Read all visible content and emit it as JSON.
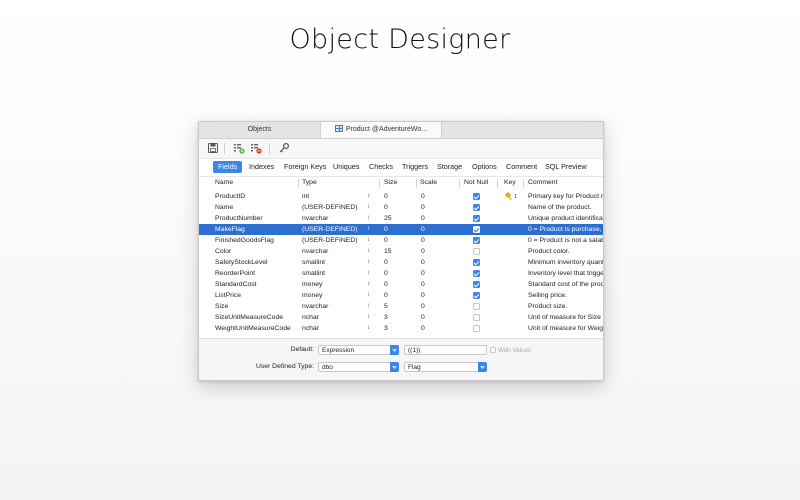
{
  "hero": {
    "title": "Object Designer"
  },
  "tabs": {
    "objects": "Objects",
    "product": "Product @AdventureWo..."
  },
  "subtabs": [
    "Fields",
    "Indexes",
    "Foreign Keys",
    "Uniques",
    "Checks",
    "Triggers",
    "Storage",
    "Options",
    "Comment",
    "SQL Preview"
  ],
  "columns": {
    "name": "Name",
    "type": "Type",
    "size": "Size",
    "scale": "Scale",
    "notnull": "Not Null",
    "key": "Key",
    "comment": "Comment"
  },
  "fields": [
    {
      "name": "ProductID",
      "type": "int",
      "size": "0",
      "scale": "0",
      "notnull": true,
      "key": true,
      "key_index": "1",
      "comment": "Primary key for Product re"
    },
    {
      "name": "Name",
      "type": "(USER-DEFINED)",
      "size": "0",
      "scale": "0",
      "notnull": true,
      "key": false,
      "comment": "Name of the product."
    },
    {
      "name": "ProductNumber",
      "type": "nvarchar",
      "size": "25",
      "scale": "0",
      "notnull": true,
      "key": false,
      "comment": "Unique product identificat"
    },
    {
      "name": "MakeFlag",
      "type": "(USER-DEFINED)",
      "size": "0",
      "scale": "0",
      "notnull": true,
      "key": false,
      "comment": "0 = Product is purchase, 1=",
      "selected": true
    },
    {
      "name": "FinishedGoodsFlag",
      "type": "(USER-DEFINED)",
      "size": "0",
      "scale": "0",
      "notnull": true,
      "key": false,
      "comment": "0 = Product is not a salabl"
    },
    {
      "name": "Color",
      "type": "nvarchar",
      "size": "15",
      "scale": "0",
      "notnull": false,
      "key": false,
      "comment": "Product color."
    },
    {
      "name": "SafetyStockLevel",
      "type": "smallint",
      "size": "0",
      "scale": "0",
      "notnull": true,
      "key": false,
      "comment": "Minimum inventory quanti"
    },
    {
      "name": "ReorderPoint",
      "type": "smallint",
      "size": "0",
      "scale": "0",
      "notnull": true,
      "key": false,
      "comment": "Inventory level that trigger"
    },
    {
      "name": "StandardCost",
      "type": "money",
      "size": "0",
      "scale": "0",
      "notnull": true,
      "key": false,
      "comment": "Standard cost of the produc"
    },
    {
      "name": "ListPrice",
      "type": "money",
      "size": "0",
      "scale": "0",
      "notnull": true,
      "key": false,
      "comment": "Selling price."
    },
    {
      "name": "Size",
      "type": "nvarchar",
      "size": "5",
      "scale": "0",
      "notnull": false,
      "key": false,
      "comment": "Product size."
    },
    {
      "name": "SizeUnitMeasureCode",
      "type": "nchar",
      "size": "3",
      "scale": "0",
      "notnull": false,
      "key": false,
      "comment": "Unit of measure for Size co"
    },
    {
      "name": "WeightUnitMeasureCode",
      "type": "nchar",
      "size": "3",
      "scale": "0",
      "notnull": false,
      "key": false,
      "comment": "Unit of measure for Weight"
    }
  ],
  "footer": {
    "default_label": "Default:",
    "default_kind": "Expression",
    "default_value": "((1))",
    "with_values": "With Values",
    "udt_label": "User Defined Type:",
    "udt_schema": "dbo",
    "udt_name": "Flag"
  },
  "colors": {
    "accent": "#3d86e6",
    "selected_row": "#2c6fd1"
  }
}
